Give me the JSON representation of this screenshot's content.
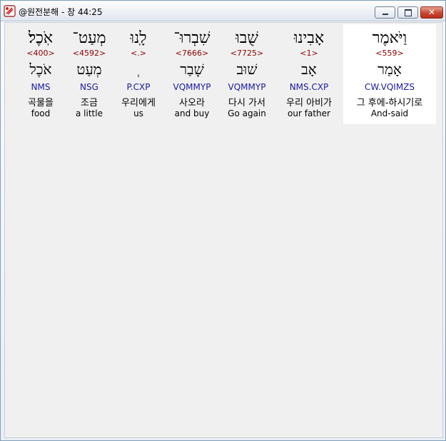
{
  "window": {
    "title": "@원전분해 - 창 44:25",
    "close_glyph": "✕"
  },
  "words": [
    {
      "hebrew": "אֹֽכֶל׃",
      "strong": "<400>",
      "lemma": "אֹכֶל",
      "morph": "NMS",
      "korean": "곡물을",
      "english": "food"
    },
    {
      "hebrew": "מְעַט־",
      "strong": "<4592>",
      "lemma": "מְעַט",
      "morph": "NSG",
      "korean": "조금",
      "english": "a little"
    },
    {
      "hebrew": "לָֽנוּ",
      "strong": "<.>",
      "lemma": "ְ",
      "morph": "P.CXP",
      "korean": "우리에게",
      "english": "us"
    },
    {
      "hebrew": "שִׁבְרוּ־",
      "strong": "<7666>",
      "lemma": "שָׁבַר",
      "morph": "VQMMYP",
      "korean": "사오라",
      "english": "and buy"
    },
    {
      "hebrew": "שֻׁבוּ",
      "strong": "<7725>",
      "lemma": "שׁוּב",
      "morph": "VQMMYP",
      "korean": "다시 가서",
      "english": "Go again"
    },
    {
      "hebrew": "אָבִינוּ",
      "strong": "<1>",
      "lemma": "אָב",
      "morph": "NMS.CXP",
      "korean": "우리 아비가",
      "english": "our father"
    },
    {
      "hebrew": "וַיֹּאמֶר",
      "strong": "<559>",
      "lemma": "אָמַר",
      "morph": "CW.VQIMZS",
      "korean": "그 후에-하시기로",
      "english": "And-said"
    }
  ]
}
